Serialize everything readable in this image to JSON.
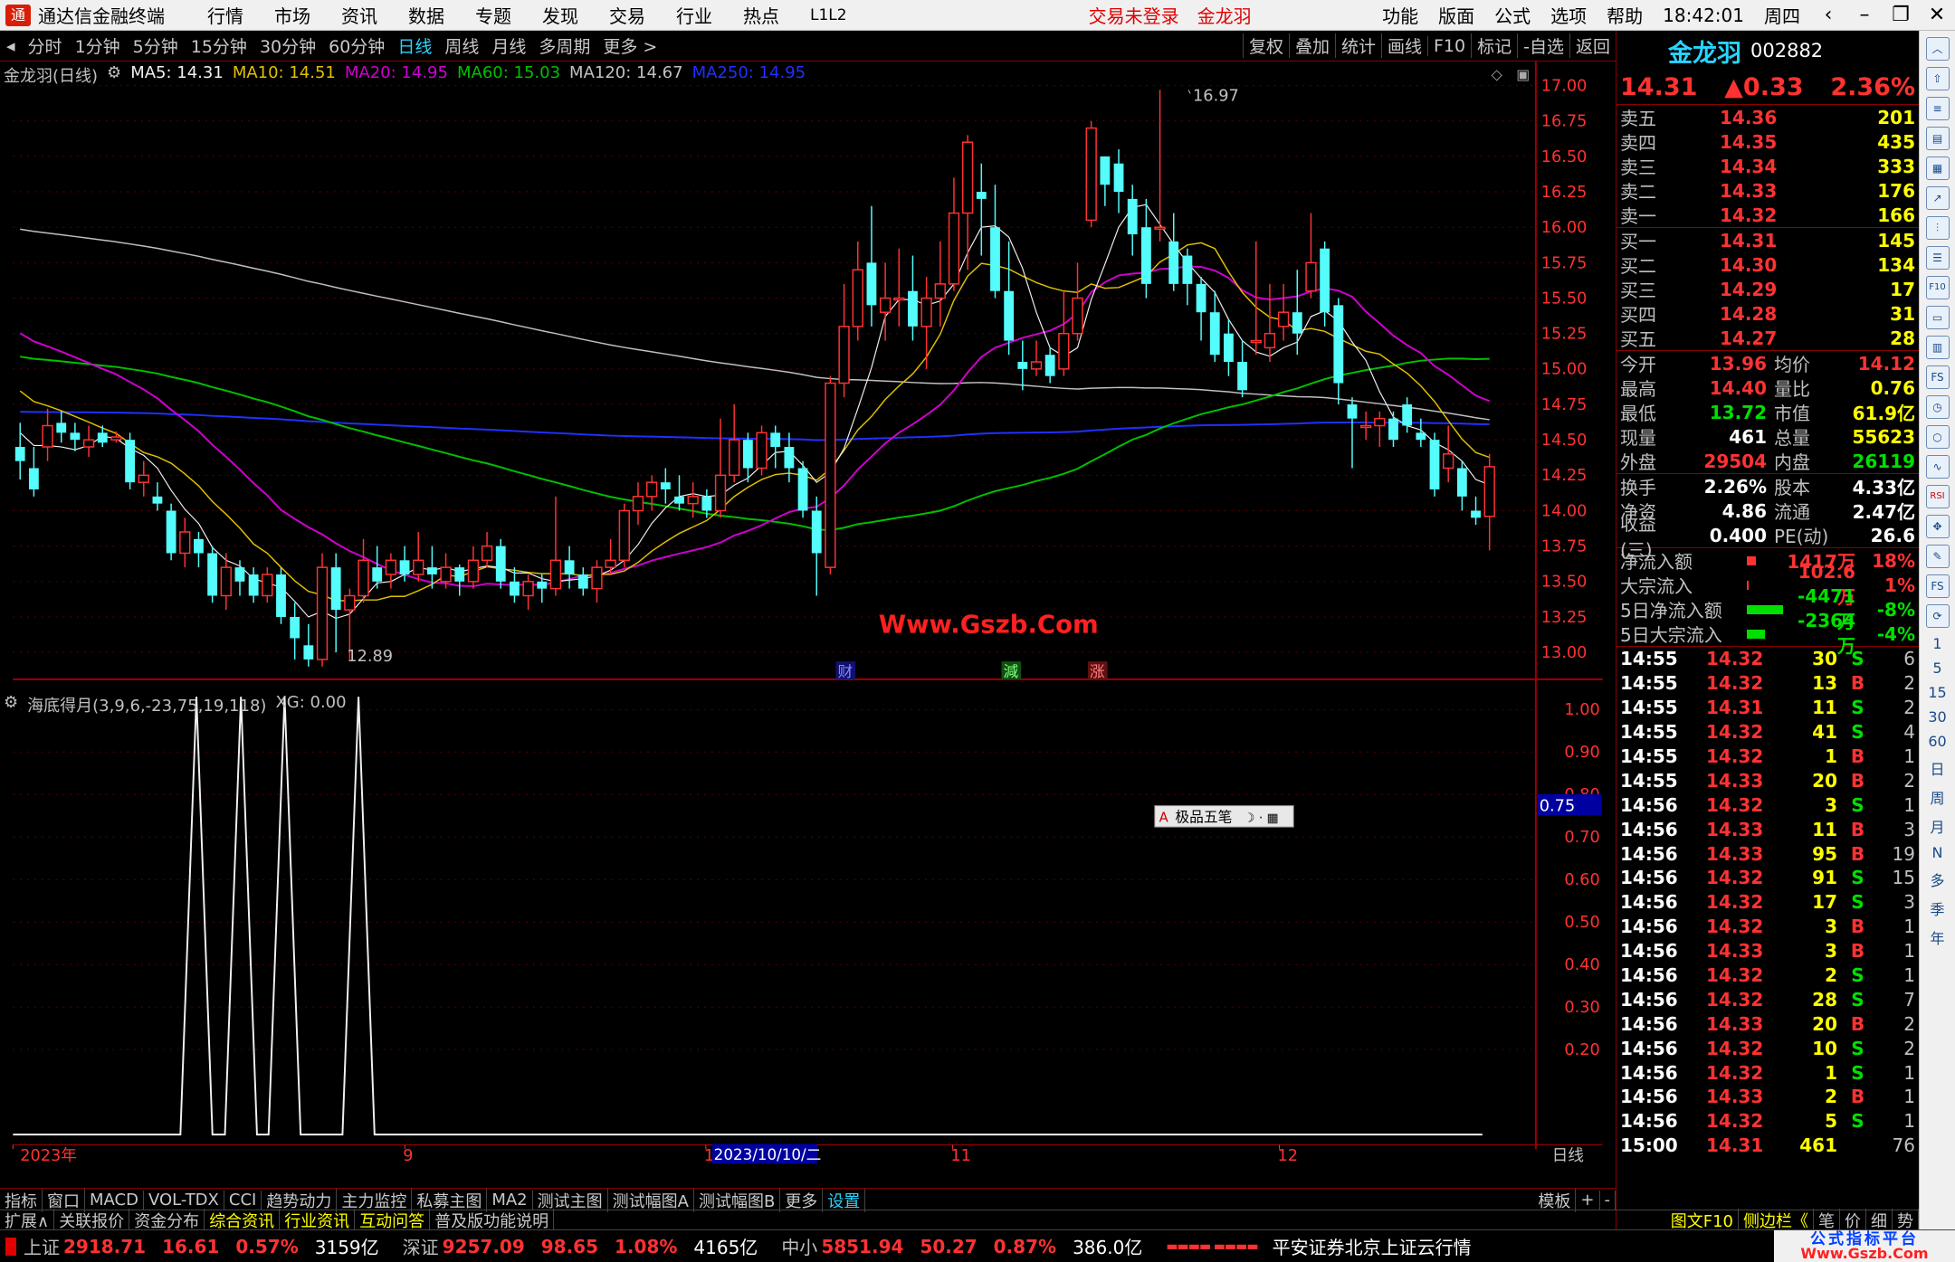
{
  "app": {
    "title": "通达信金融终端",
    "menu": [
      "行情",
      "市场",
      "资讯",
      "数据",
      "专题",
      "发现",
      "交易",
      "行业",
      "热点",
      "L1L2"
    ],
    "login_status": "交易未登录",
    "stock_tag": "金龙羽",
    "right_menu": [
      "功能",
      "版面",
      "公式",
      "选项",
      "帮助"
    ],
    "time": "18:42:01",
    "weekday": "周四"
  },
  "periods": [
    "分时",
    "1分钟",
    "5分钟",
    "15分钟",
    "30分钟",
    "60分钟",
    "日线",
    "周线",
    "月线",
    "多周期",
    "更多 >"
  ],
  "active_period": "日线",
  "tools": [
    "复权",
    "叠加",
    "统计",
    "画线",
    "F10",
    "标记",
    "-自选",
    "返回"
  ],
  "chart_header": {
    "title": "金龙羽(日线)",
    "ma5": "MA5: 14.31",
    "ma10": "MA10: 14.51",
    "ma20": "MA20: 14.95",
    "ma60": "MA60: 15.03",
    "ma120": "MA120: 14.67",
    "ma250": "MA250: 14.95"
  },
  "watermark": "Www.Gszb.Com",
  "price_axis": [
    "17.00",
    "16.75",
    "16.50",
    "16.25",
    "16.00",
    "15.75",
    "15.50",
    "15.25",
    "15.00",
    "14.75",
    "14.50",
    "14.25",
    "14.00",
    "13.75",
    "13.50",
    "13.25",
    "13.00"
  ],
  "high_label": "16.97",
  "low_label": "12.89",
  "event_markers": [
    "财",
    "減",
    "涨"
  ],
  "indicator": {
    "title": "海底得月(3,9,6,-23,75,19,118)",
    "xg": "XG: 0.00",
    "axis": [
      "1.00",
      "0.90",
      "0.80",
      "0.70",
      "0.60",
      "0.50",
      "0.40",
      "0.30",
      "0.20"
    ],
    "cursor_value": "0.75"
  },
  "time_axis": {
    "labels": [
      "2023年",
      "9",
      "1",
      "11",
      "12"
    ],
    "cursor": "2023/10/10/二",
    "right": "日线"
  },
  "toolbox": {
    "label": "极品五笔"
  },
  "quote": {
    "name": "金龙羽",
    "code": "002882",
    "price": "14.31",
    "change": "▲0.33",
    "pct": "2.36%"
  },
  "orderbook": {
    "asks": [
      {
        "l": "卖五",
        "p": "14.36",
        "v": "201"
      },
      {
        "l": "卖四",
        "p": "14.35",
        "v": "435"
      },
      {
        "l": "卖三",
        "p": "14.34",
        "v": "333"
      },
      {
        "l": "卖二",
        "p": "14.33",
        "v": "176"
      },
      {
        "l": "卖一",
        "p": "14.32",
        "v": "166"
      }
    ],
    "bids": [
      {
        "l": "买一",
        "p": "14.31",
        "v": "145"
      },
      {
        "l": "买二",
        "p": "14.30",
        "v": "134"
      },
      {
        "l": "买三",
        "p": "14.29",
        "v": "17"
      },
      {
        "l": "买四",
        "p": "14.28",
        "v": "31"
      },
      {
        "l": "买五",
        "p": "14.27",
        "v": "28"
      }
    ]
  },
  "stats1": [
    {
      "k": "今开",
      "v": "13.96",
      "k2": "均价",
      "v2": "14.12"
    },
    {
      "k": "最高",
      "v": "14.40",
      "k2": "量比",
      "v2": "0.76"
    },
    {
      "k": "最低",
      "v": "13.72",
      "k2": "市值",
      "v2": "61.9亿"
    },
    {
      "k": "现量",
      "v": "461",
      "k2": "总量",
      "v2": "55623"
    },
    {
      "k": "外盘",
      "v": "29504",
      "k2": "内盘",
      "v2": "26119"
    }
  ],
  "stats2": [
    {
      "k": "换手",
      "v": "2.26%",
      "k2": "股本",
      "v2": "4.33亿"
    },
    {
      "k": "净资",
      "v": "4.86",
      "k2": "流通",
      "v2": "2.47亿"
    },
    {
      "k": "收益(三)",
      "v": "0.400",
      "k2": "PE(动)",
      "v2": "26.6"
    }
  ],
  "flows": [
    {
      "k": "净流入额",
      "v": "1417万",
      "p": "18%",
      "c": "#ff3232",
      "w": 10
    },
    {
      "k": "大宗流入",
      "v": "102.6万",
      "p": "1%",
      "c": "#ff3232",
      "w": 2
    },
    {
      "k": "5日净流入额",
      "v": "-4471万",
      "p": "-8%",
      "c": "#00e000",
      "w": 40
    },
    {
      "k": "5日大宗流入",
      "v": "-2364万",
      "p": "-4%",
      "c": "#00e000",
      "w": 20
    }
  ],
  "ticks": [
    [
      "14:55",
      "14.32",
      "30",
      "S",
      "6"
    ],
    [
      "14:55",
      "14.32",
      "13",
      "B",
      "2"
    ],
    [
      "14:55",
      "14.31",
      "11",
      "S",
      "2"
    ],
    [
      "14:55",
      "14.32",
      "41",
      "S",
      "4"
    ],
    [
      "14:55",
      "14.32",
      "1",
      "B",
      "1"
    ],
    [
      "14:55",
      "14.33",
      "20",
      "B",
      "2"
    ],
    [
      "14:56",
      "14.32",
      "3",
      "S",
      "1"
    ],
    [
      "14:56",
      "14.33",
      "11",
      "B",
      "3"
    ],
    [
      "14:56",
      "14.33",
      "95",
      "B",
      "19"
    ],
    [
      "14:56",
      "14.32",
      "91",
      "S",
      "15"
    ],
    [
      "14:56",
      "14.32",
      "17",
      "S",
      "3"
    ],
    [
      "14:56",
      "14.32",
      "3",
      "B",
      "1"
    ],
    [
      "14:56",
      "14.33",
      "3",
      "B",
      "1"
    ],
    [
      "14:56",
      "14.32",
      "2",
      "S",
      "1"
    ],
    [
      "14:56",
      "14.32",
      "28",
      "S",
      "7"
    ],
    [
      "14:56",
      "14.33",
      "20",
      "B",
      "2"
    ],
    [
      "14:56",
      "14.32",
      "10",
      "S",
      "2"
    ],
    [
      "14:56",
      "14.32",
      "1",
      "S",
      "1"
    ],
    [
      "14:56",
      "14.33",
      "2",
      "B",
      "1"
    ],
    [
      "14:56",
      "14.32",
      "5",
      "S",
      "1"
    ],
    [
      "15:00",
      "14.31",
      "461",
      "",
      "76"
    ]
  ],
  "bottom_tabs": [
    "指标",
    "窗口",
    "MACD",
    "VOL-TDX",
    "CCI",
    "趋势动力",
    "主力监控",
    "私募主图",
    "MA2",
    "测试主图",
    "测试幅图A",
    "测试幅图B",
    "更多",
    "设置"
  ],
  "bottom_right": [
    "模板",
    "+",
    "-"
  ],
  "bottom_tabs2": [
    "扩展∧",
    "关联报价",
    "资金分布",
    "综合资讯",
    "行业资讯",
    "互动问答",
    "普及版功能说明"
  ],
  "bottom_right2": [
    "图文F10",
    "侧边栏《",
    "笔",
    "价",
    "细",
    "势"
  ],
  "side_icons": [
    "日",
    "周",
    "月",
    "N",
    "多",
    "季",
    "年",
    "15",
    "30",
    "60",
    "RSI",
    "FS",
    "F10"
  ],
  "status": {
    "indices": [
      {
        "nm": "上证",
        "v": "2918.71",
        "c": "16.61",
        "p": "0.57%",
        "a": "3159亿"
      },
      {
        "nm": "深证",
        "v": "9257.09",
        "c": "98.65",
        "p": "1.08%",
        "a": "4165亿"
      },
      {
        "nm": "中小",
        "v": "5851.94",
        "c": "50.27",
        "p": "0.87%",
        "a": "386.0亿"
      }
    ],
    "broker": "平安证券北京上证云行情",
    "brand": "公式指标平台",
    "brand_url": "Www.Gszb.Com"
  }
}
